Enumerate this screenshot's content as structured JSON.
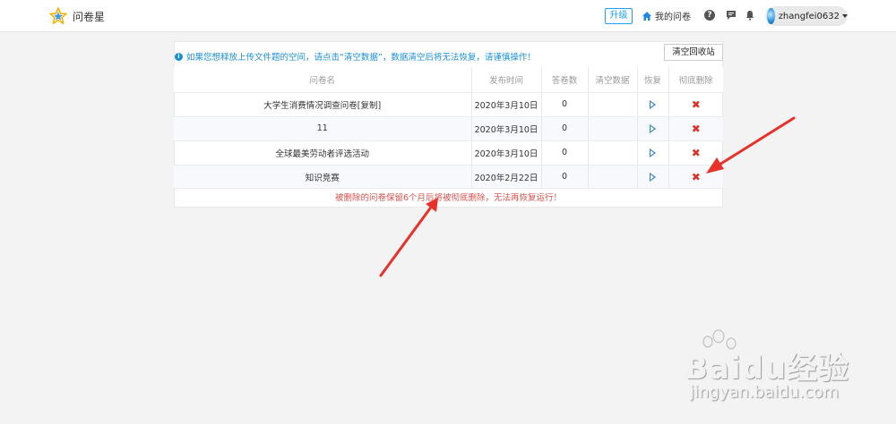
{
  "header": {
    "logo_text": "问卷星",
    "upgrade_label": "升级",
    "my_surveys_label": "我的问卷",
    "help_glyph": "?",
    "username": "zhangfei0632"
  },
  "notice": {
    "info_glyph": "i",
    "text": "如果您想释放上传文件题的空间，请点击“清空数据”，数据清空后将无法恢复，请谨慎操作！",
    "clear_bin_label": "清空回收站"
  },
  "table": {
    "columns": [
      "问卷名",
      "发布时间",
      "答卷数",
      "清空数据",
      "恢复",
      "彻底删除"
    ],
    "rows": [
      {
        "name": "大学生消费情况调查问卷[复制]",
        "date": "2020年3月10日",
        "answers": "0",
        "clear": ""
      },
      {
        "name": "11",
        "date": "2020年3月10日",
        "answers": "0",
        "clear": ""
      },
      {
        "name": "全球最美劳动者评选活动",
        "date": "2020年3月10日",
        "answers": "0",
        "clear": ""
      },
      {
        "name": "知识竞赛",
        "date": "2020年2月22日",
        "answers": "0",
        "clear": ""
      }
    ],
    "restore_icon": "restore-play-icon",
    "delete_icon": "delete-x-icon",
    "delete_glyph": "✖"
  },
  "footer_note": "被删除的问卷保留6个月后将被彻底删除，无法再恢复运行！",
  "watermark": {
    "brand": "Baidu经验",
    "domain": "jingyan.baidu.com"
  },
  "colors": {
    "accent": "#1ea0fa",
    "notice": "#1a8fd9",
    "danger": "#d9342b",
    "arrow": "#e8312a"
  }
}
